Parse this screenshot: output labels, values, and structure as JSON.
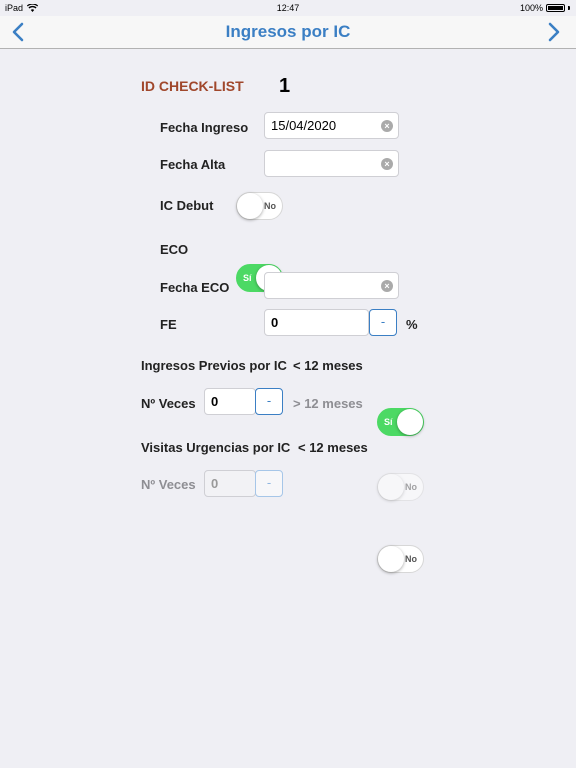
{
  "status": {
    "device": "iPad",
    "time": "12:47",
    "battery": "100%"
  },
  "nav": {
    "title": "Ingresos por IC"
  },
  "form": {
    "id_label": "ID CHECK-LIST",
    "id_value": "1",
    "fecha_ingreso": {
      "label": "Fecha Ingreso",
      "value": "15/04/2020"
    },
    "fecha_alta": {
      "label": "Fecha Alta",
      "value": ""
    },
    "ic_debut": {
      "label": "IC Debut",
      "toggle": "No"
    },
    "eco": {
      "label": "ECO",
      "toggle": "Sí"
    },
    "fecha_eco": {
      "label": "Fecha ECO",
      "value": ""
    },
    "fe": {
      "label": "FE",
      "value": "0",
      "stepper": "-",
      "unit": "%"
    },
    "ingresos_previos": {
      "label": "Ingresos Previos por IC",
      "lt12": "< 12 meses",
      "toggle": "Sí"
    },
    "n_veces_1": {
      "label": "Nº Veces",
      "value": "0",
      "stepper": "-",
      "gt12": "> 12 meses",
      "toggle": "No"
    },
    "visitas_urgencias": {
      "label": "Visitas Urgencias por IC",
      "lt12": "< 12 meses",
      "toggle": "No"
    },
    "n_veces_2": {
      "label": "Nº Veces",
      "value": "0",
      "stepper": "-"
    }
  },
  "colors": {
    "accent": "#3b7fc4",
    "id_label": "#a0472b",
    "switch_on": "#4cd964"
  }
}
